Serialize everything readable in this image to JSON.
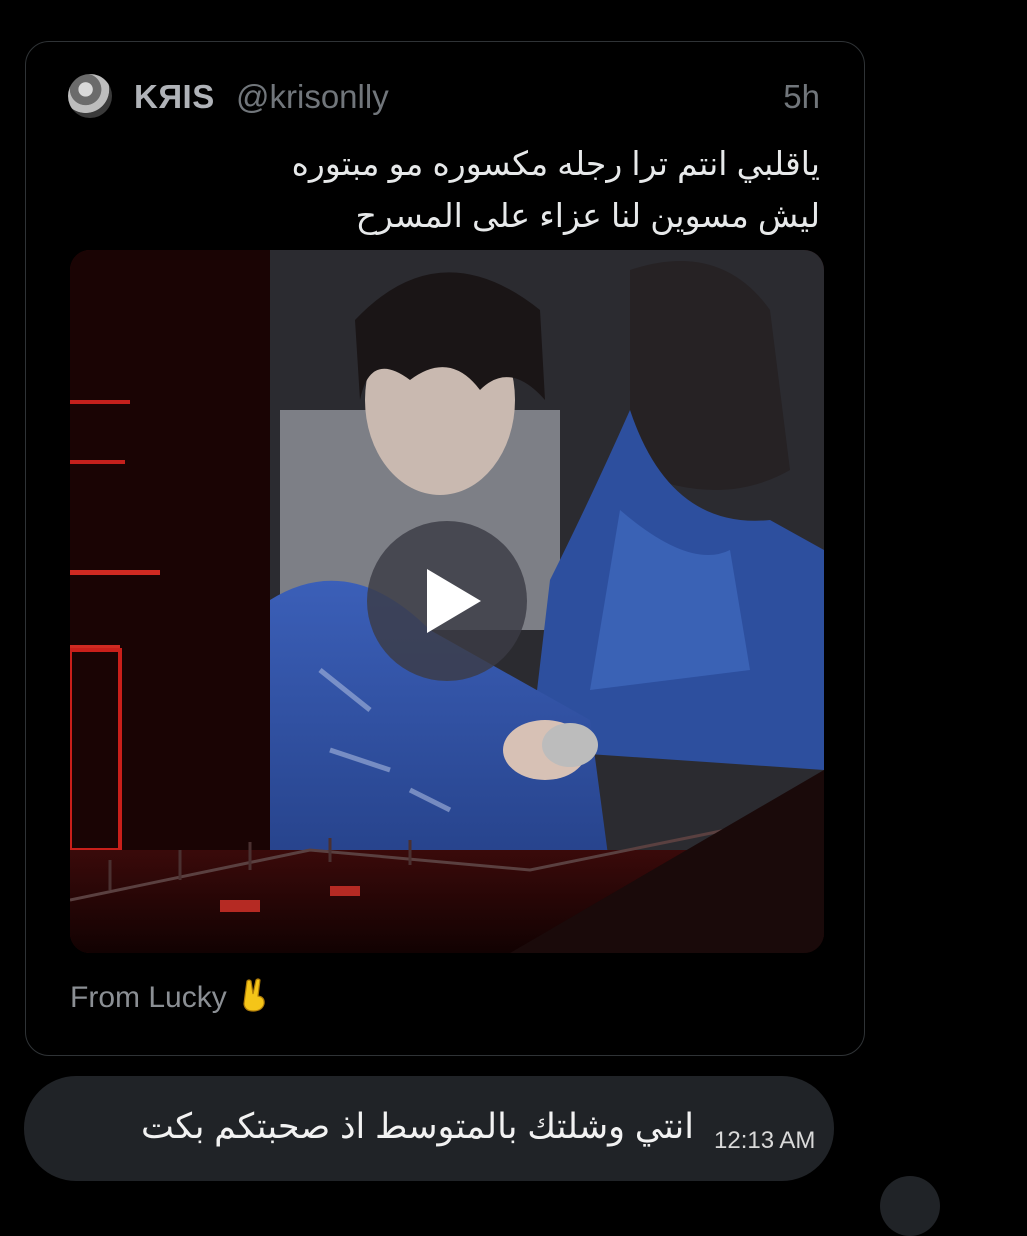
{
  "quoted_post": {
    "author_name": "KЯIS",
    "author_handle": "@krisonlly",
    "time": "5h",
    "text_lines": [
      "ياقلبي انتم ترا رجله مكسوره مو مبتوره",
      "ليش مسوين لنا عزاء على المسرح"
    ],
    "media": {
      "type": "video",
      "play_icon": "play-icon"
    },
    "from_text": "From Lucky",
    "from_emoji": "victory-hand-emoji"
  },
  "message": {
    "text": "انتي وشلتك بالمتوسط اذ صحبتكم بكت",
    "time": "12:13 AM"
  },
  "colors": {
    "background": "#000000",
    "bubble": "#202327",
    "border": "#2f3336",
    "muted_text": "#71767b"
  }
}
